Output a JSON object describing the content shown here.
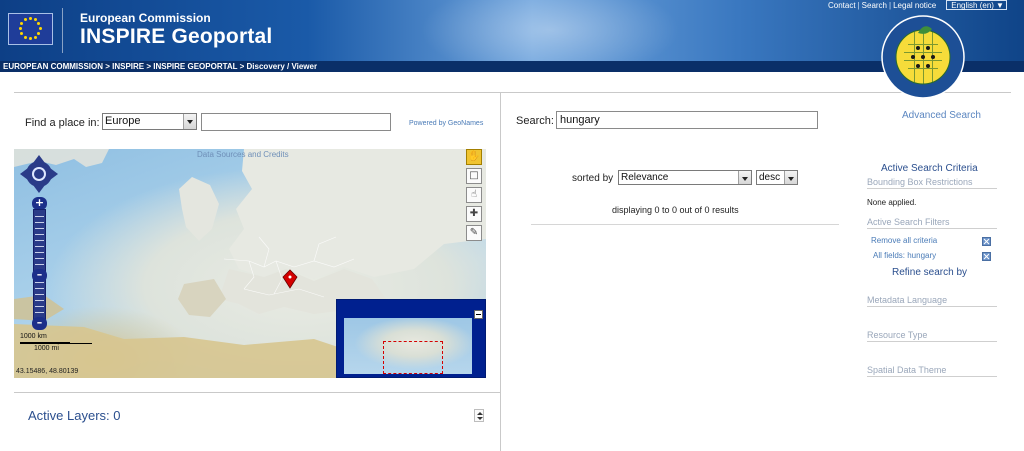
{
  "header": {
    "subtitle": "European Commission",
    "title": "INSPIRE Geoportal",
    "links": [
      "Contact",
      "Search",
      "Legal notice"
    ],
    "language": "English (en)",
    "badge_ring_text": "INSPIRE · Infrastructure for Spatial Information in Europe"
  },
  "breadcrumb": "EUROPEAN COMMISSION > INSPIRE > INSPIRE GEOPORTAL > Discovery / Viewer",
  "finder": {
    "label": "Find a place in:",
    "region": "Europe",
    "place_value": "",
    "powered_by": "Powered by GeoNames"
  },
  "map": {
    "credits": "Data Sources and Credits",
    "scale_km": "1000 km",
    "scale_mi": "1000 mi",
    "coordinates": "43.15486, 48.80139"
  },
  "layers": {
    "label": "Active Layers: 0"
  },
  "search": {
    "label": "Search:",
    "value": "hungary",
    "advanced": "Advanced Search",
    "sorted_by_label": "sorted by",
    "sort_field": "Relevance",
    "sort_order": "desc",
    "results_text": "displaying 0 to 0 out of 0 results"
  },
  "criteria": {
    "title": "Active Search Criteria",
    "bbox_heading": "Bounding Box Restrictions",
    "bbox_value": "None applied.",
    "filters_heading": "Active Search Filters",
    "remove_all": "Remove all criteria",
    "filter_item": "All fields: hungary",
    "refine_title": "Refine search by",
    "facets": [
      "Metadata Language",
      "Resource Type",
      "Spatial Data Theme"
    ]
  },
  "colors": {
    "header_dark": "#0d3f86",
    "breadcrumb_bg": "#0a2f68",
    "link": "#4a7bb7",
    "heading": "#2b4f8e",
    "map_marker": "#d40000"
  }
}
